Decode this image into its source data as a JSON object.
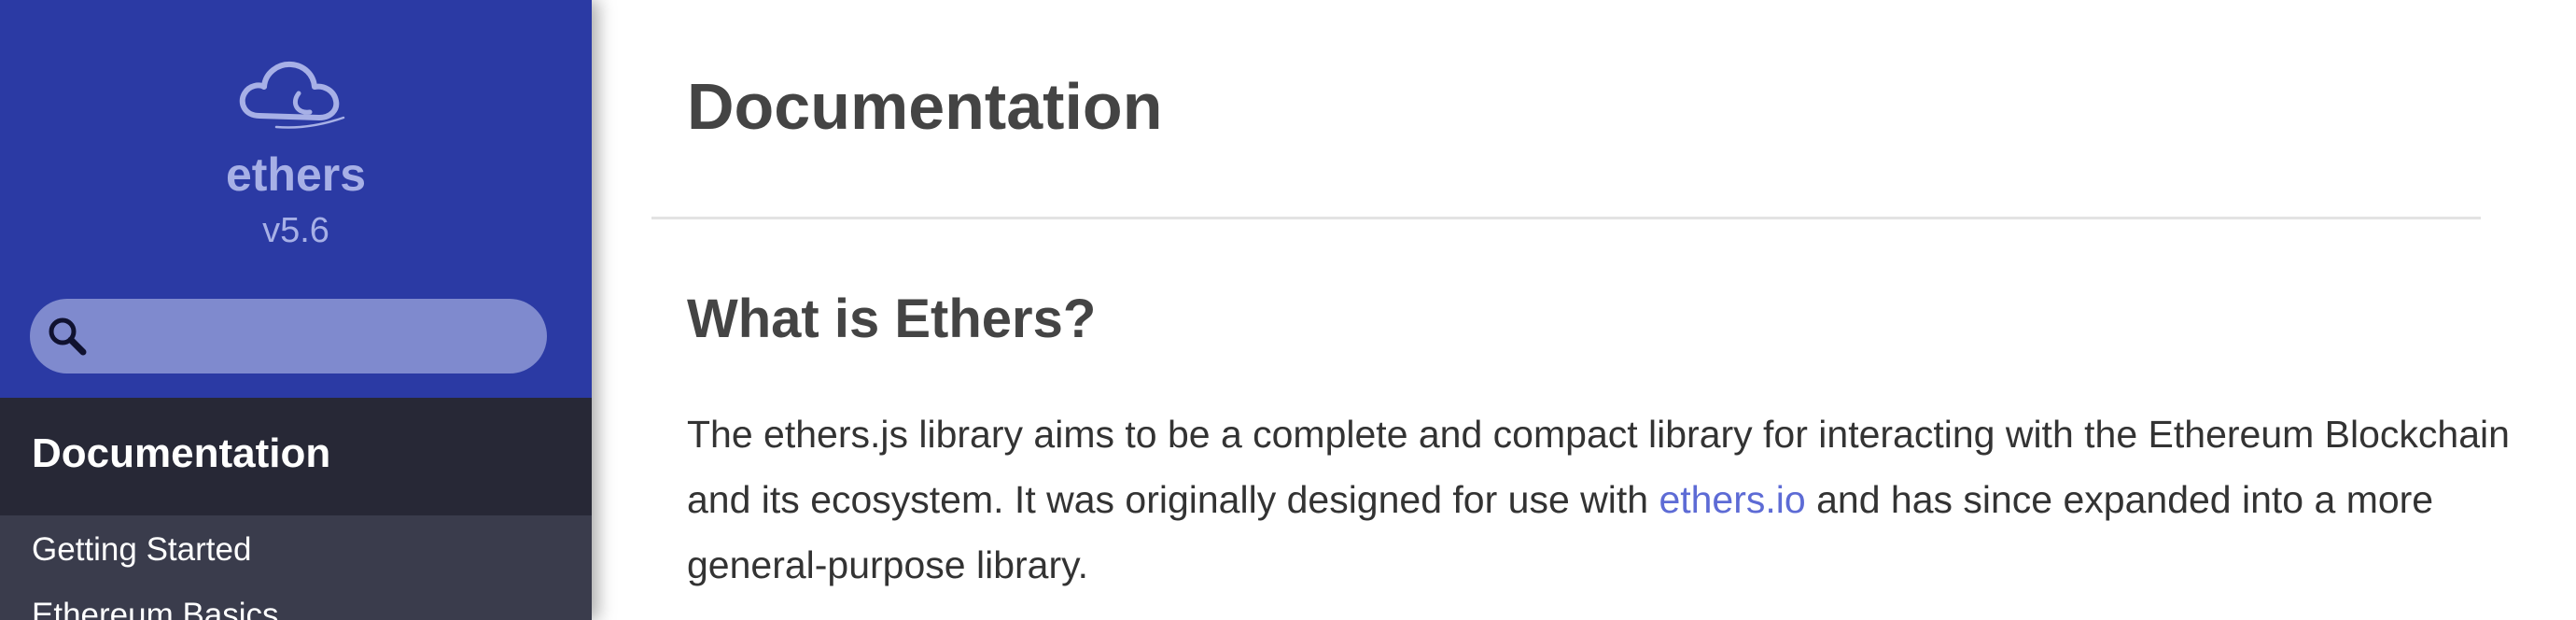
{
  "sidebar": {
    "brand": {
      "name": "ethers",
      "version": "v5.6"
    },
    "search": {
      "placeholder": "",
      "value": ""
    },
    "section_title": "Documentation",
    "items": [
      {
        "label": "Getting Started"
      },
      {
        "label": "Ethereum Basics"
      }
    ]
  },
  "main": {
    "title": "Documentation",
    "section": {
      "heading": "What is Ethers?",
      "text_before_link": "The ethers.js library aims to be a complete and compact library for interacting with the Ethereum Blockchain and its ecosystem. It was originally designed for use with ",
      "link_text": "ethers.io",
      "text_after_link": " and has since expanded into a more general-purpose library."
    }
  },
  "colors": {
    "sidebar_header_bg": "#2b3aa4",
    "sidebar_brand_text": "#a7b0e6",
    "search_bg": "#7f8ace",
    "sidebar_section_bg": "#272836",
    "sidebar_bg": "#3a3c4c",
    "link": "#5d6bd5",
    "heading_text": "#444444"
  }
}
